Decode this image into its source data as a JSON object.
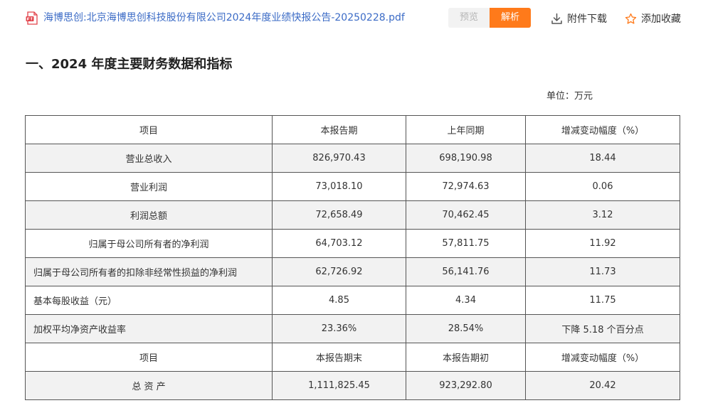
{
  "header": {
    "file_title": "海博思创:北京海博思创科技股份有限公司2024年度业绩快报公告-20250228.pdf",
    "preview_label": "预览",
    "parse_label": "解析",
    "download_label": "附件下载",
    "favorite_label": "添加收藏"
  },
  "section": {
    "title": "一、2024 年度主要财务数据和指标",
    "unit": "单位：万元"
  },
  "colors": {
    "link": "#3b6bc6",
    "accent": "#ff7a1a",
    "band": "#f2f2f2"
  },
  "table": {
    "header1": [
      "项目",
      "本报告期",
      "上年同期",
      "增减变动幅度（%）"
    ],
    "rows1": [
      {
        "item": "营业总收入",
        "current": "826,970.43",
        "prior": "698,190.98",
        "change": "18.44"
      },
      {
        "item": "营业利润",
        "current": "73,018.10",
        "prior": "72,974.63",
        "change": "0.06"
      },
      {
        "item": "利润总额",
        "current": "72,658.49",
        "prior": "70,462.45",
        "change": "3.12"
      },
      {
        "item": "归属于母公司所有者的净利润",
        "current": "64,703.12",
        "prior": "57,811.75",
        "change": "11.92"
      },
      {
        "item": "归属于母公司所有者的扣除非经常性损益的净利润",
        "current": "62,726.92",
        "prior": "56,141.76",
        "change": "11.73"
      },
      {
        "item": "基本每股收益（元）",
        "current": "4.85",
        "prior": "4.34",
        "change": "11.75"
      },
      {
        "item": "加权平均净资产收益率",
        "current": "23.36%",
        "prior": "28.54%",
        "change": "下降 5.18 个百分点"
      }
    ],
    "header2": [
      "项目",
      "本报告期末",
      "本报告期初",
      "增减变动幅度（%）"
    ],
    "rows2": [
      {
        "item": "总 资 产",
        "current": "1,111,825.45",
        "prior": "923,292.80",
        "change": "20.42"
      }
    ]
  }
}
